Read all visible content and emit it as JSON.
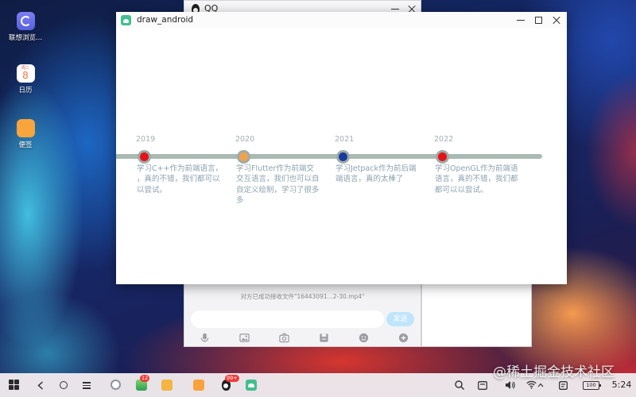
{
  "desktop": {
    "icons": [
      {
        "label": "联想浏览...",
        "icon": "browser-icon",
        "color": "#6a70ea"
      },
      {
        "label": "日历",
        "icon": "calendar-icon",
        "weekday": "周二",
        "day": "8"
      },
      {
        "label": "便签",
        "icon": "notes-icon",
        "color": "#f8a53d"
      }
    ]
  },
  "qq_window": {
    "title": "QQ",
    "status_text": "对方已成功接收文件\"16443091...2-30.mp4\"",
    "message_input": {
      "value": ""
    },
    "send_label": "发送",
    "send_color": "#bfe5fa",
    "toolbar_icons": [
      "mic-icon",
      "image-icon",
      "camera-icon",
      "file-icon",
      "emoji-icon",
      "plus-icon"
    ]
  },
  "main_window": {
    "title": "draw_android",
    "app_icon": "draw-android-app-icon",
    "title_controls": [
      "minimize-icon",
      "maximize-icon",
      "close-icon"
    ],
    "timeline": {
      "line_color": "#a9bab2",
      "ring_color": "#9eaca6",
      "year_color": "#a4afb6",
      "text_color": "#8da2b0",
      "events": [
        {
          "year": "2019",
          "dot_color": "#e4131b",
          "lines": [
            "学习C++作为前端语言，",
            "，真的不错，我们都可以",
            "以尝试。"
          ]
        },
        {
          "year": "2020",
          "dot_color": "#f2a14c",
          "lines": [
            "学习Flutter作为前端交",
            "交互语言，我们也可以自",
            "自定义绘制，学习了很多",
            "多"
          ]
        },
        {
          "year": "2021",
          "dot_color": "#1b3a9e",
          "lines": [
            "学习Jetpack作为前后端",
            "端语言，真的太棒了"
          ]
        },
        {
          "year": "2022",
          "dot_color": "#e4131b",
          "lines": [
            "学习OpenGL作为前端语",
            "语言，真的不错，我们都",
            "都可以以尝试。"
          ]
        }
      ]
    }
  },
  "taskbar": {
    "nav_icons": [
      "start-grid-icon",
      "back-icon",
      "home-icon",
      "recents-icon"
    ],
    "apps": [
      {
        "icon": "browser-app-icon"
      },
      {
        "icon": "messaging-app-icon",
        "badge": "12"
      },
      {
        "icon": "file-manager-app-icon"
      },
      {
        "icon": "notes-app-icon"
      },
      {
        "icon": "qq-app-icon",
        "badge": "99+"
      },
      {
        "icon": "draw-android-app-icon"
      }
    ],
    "tray": {
      "icons": [
        "search-icon",
        "screen-icon",
        "volume-icon",
        "wifi-icon",
        "chevron-up-icon",
        "notification-icon"
      ],
      "battery": "100",
      "time": "5:24"
    }
  },
  "watermark": "@稀土掘金技术社区"
}
